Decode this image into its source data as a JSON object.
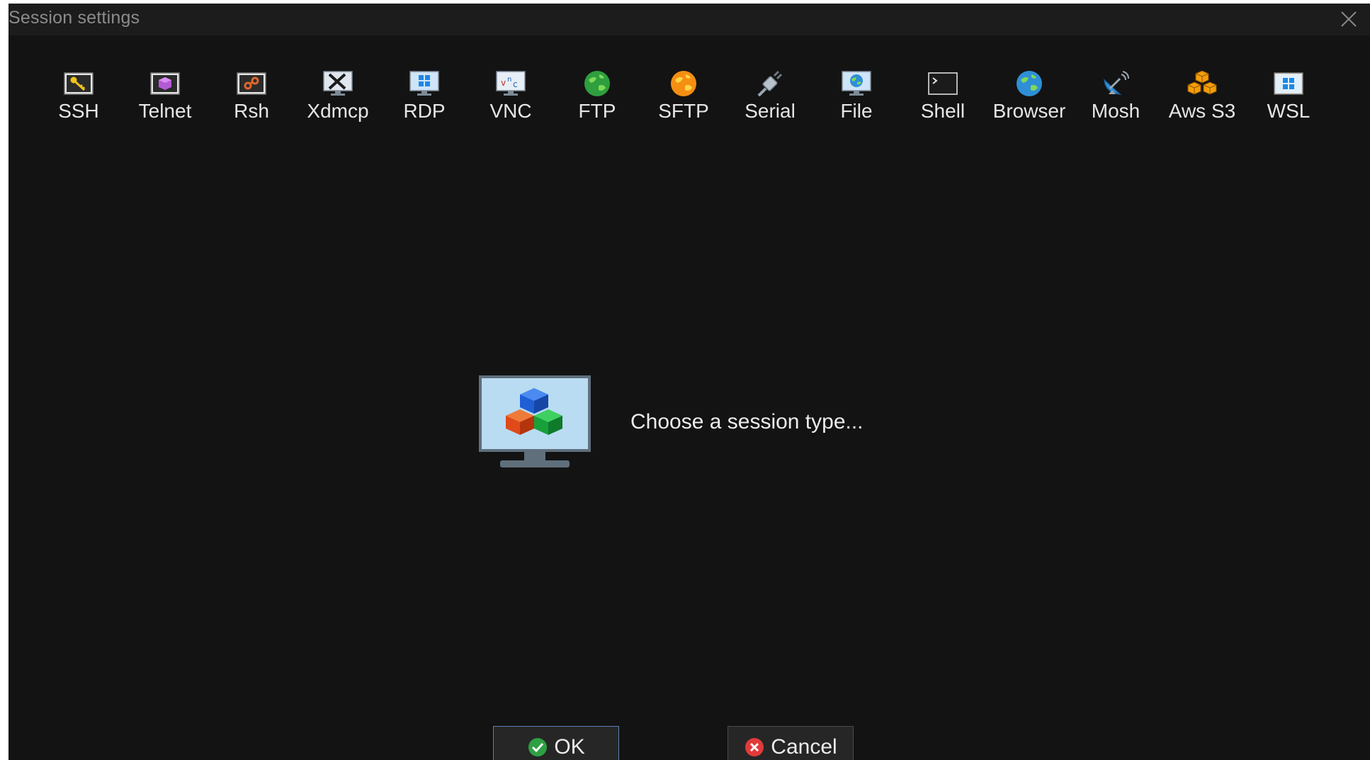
{
  "window": {
    "title": "Session settings"
  },
  "toolbar": {
    "items": [
      {
        "label": "SSH",
        "icon": "key-icon"
      },
      {
        "label": "Telnet",
        "icon": "telnet-icon"
      },
      {
        "label": "Rsh",
        "icon": "rsh-icon"
      },
      {
        "label": "Xdmcp",
        "icon": "x-monitor-icon"
      },
      {
        "label": "RDP",
        "icon": "windows-monitor-icon"
      },
      {
        "label": "VNC",
        "icon": "vnc-monitor-icon"
      },
      {
        "label": "FTP",
        "icon": "green-globe-icon"
      },
      {
        "label": "SFTP",
        "icon": "orange-globe-icon"
      },
      {
        "label": "Serial",
        "icon": "serial-plug-icon"
      },
      {
        "label": "File",
        "icon": "file-monitor-icon"
      },
      {
        "label": "Shell",
        "icon": "terminal-icon"
      },
      {
        "label": "Browser",
        "icon": "blue-globe-icon"
      },
      {
        "label": "Mosh",
        "icon": "satellite-dish-icon"
      },
      {
        "label": "Aws S3",
        "icon": "cubes-icon"
      },
      {
        "label": "WSL",
        "icon": "wsl-windows-icon"
      }
    ]
  },
  "main": {
    "hint": "Choose a session type..."
  },
  "buttons": {
    "ok_label": "OK",
    "cancel_label": "Cancel"
  },
  "colors": {
    "background": "#131313",
    "titlebar": "#1c1c1c",
    "accent": "#5a7fb5"
  }
}
